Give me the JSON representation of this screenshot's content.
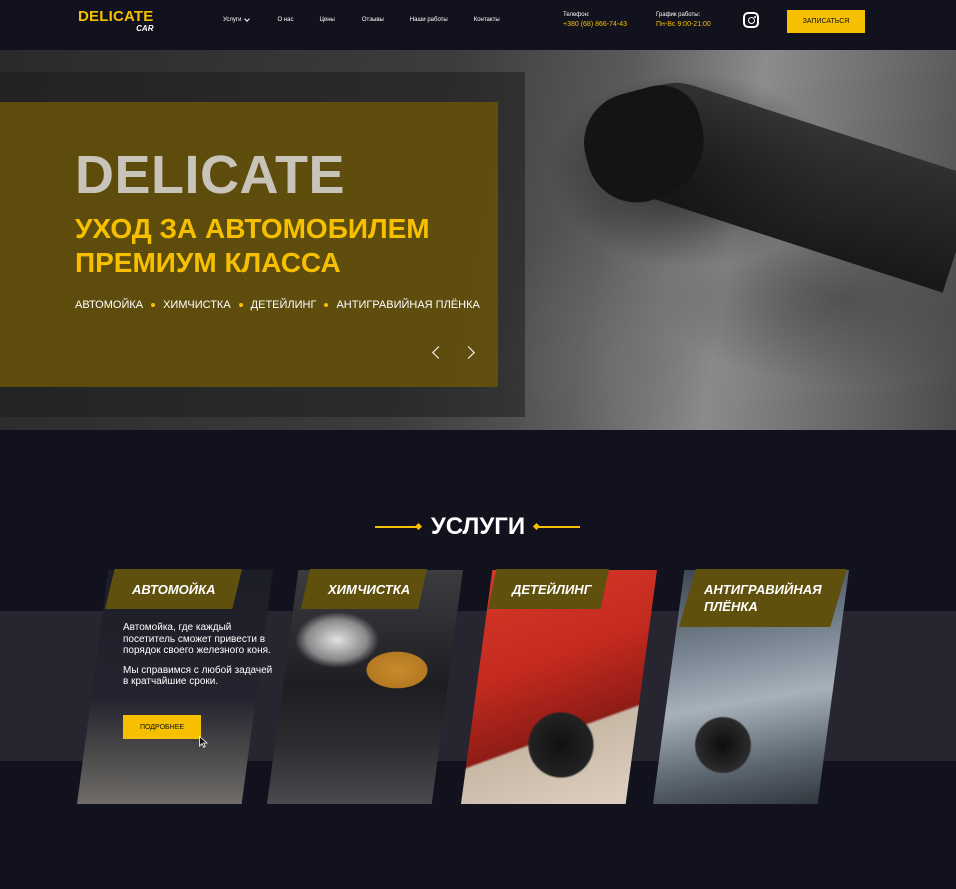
{
  "header": {
    "logo_main": "DELICATE",
    "logo_sub": "CAR",
    "nav": [
      {
        "label": "Услуги",
        "has_dropdown": true
      },
      {
        "label": "О нас"
      },
      {
        "label": "Цены"
      },
      {
        "label": "Отзывы"
      },
      {
        "label": "Наши работы"
      },
      {
        "label": "Контакты"
      }
    ],
    "phone_label": "Телефон:",
    "phone_value": "+380 (68) 866-74-43",
    "schedule_label": "График работы:",
    "schedule_value": "Пн-Вс 9:00-21:00",
    "instagram_icon": "instagram-icon",
    "book_button": "ЗАПИСАТЬСЯ"
  },
  "hero": {
    "title": "DELICATE",
    "subtitle_line1": "УХОД ЗА АВТОМОБИЛЕМ",
    "subtitle_line2": "ПРЕМИУМ КЛАССА",
    "tags": [
      "АВТОМОЙКА",
      "ХИМЧИСТКА",
      "ДЕТЕЙЛИНГ",
      "АНТИГРАВИЙНАЯ ПЛЁНКА"
    ],
    "prev_icon": "chevron-left-icon",
    "next_icon": "chevron-right-icon"
  },
  "services": {
    "title": "УСЛУГИ",
    "cards": [
      {
        "title": "АВТОМОЙКА"
      },
      {
        "title": "ХИМЧИСТКА"
      },
      {
        "title": "ДЕТЕЙЛИНГ"
      },
      {
        "title_line1": "АНТИГРАВИЙНАЯ",
        "title_line2": "ПЛЁНКА"
      }
    ],
    "description_1": "Автомойка, где каждый посетитель сможет привести в порядок своего железного коня.",
    "description_2": "Мы справимся с любой задачей в кратчайшие сроки.",
    "more_button": "ПОДРОБНЕЕ"
  },
  "colors": {
    "accent": "#f6c000",
    "background": "#11121d",
    "band": "#262530",
    "tag": "#5f500e"
  }
}
